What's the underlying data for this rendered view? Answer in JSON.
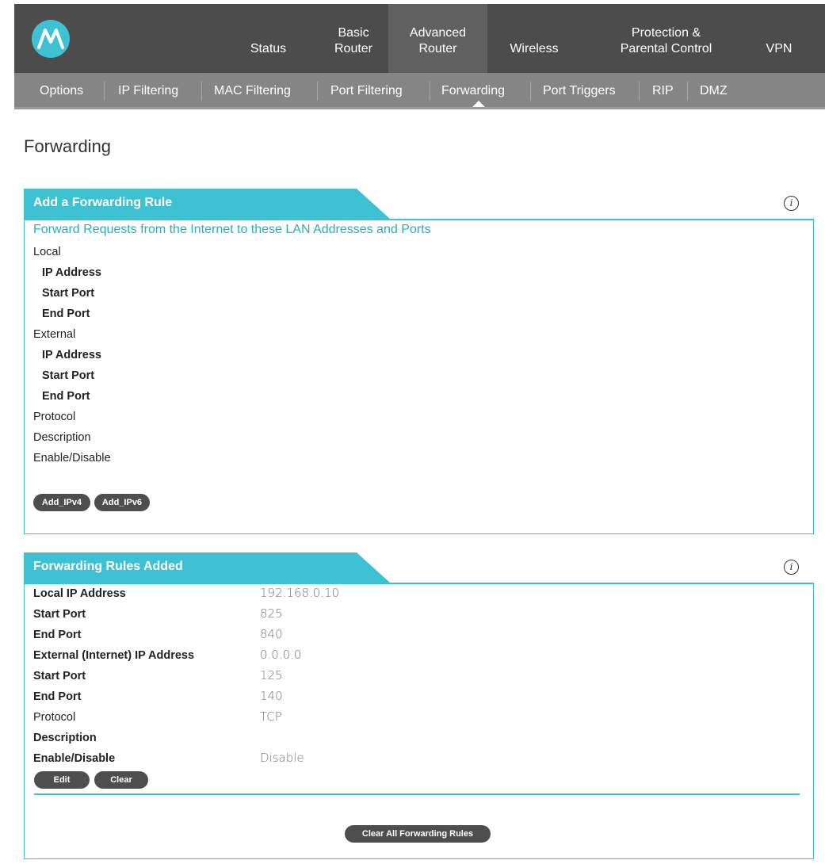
{
  "colors": {
    "accent": "#3fc1d4",
    "nav_bg": "#4c4c4c",
    "nav_active": "#606060",
    "subnav_bg": "#858585",
    "pill": "#4e4e4e"
  },
  "logo": {
    "icon": "motorola-logo-icon"
  },
  "nav": {
    "items": [
      {
        "label": "Status"
      },
      {
        "label": "Basic\nRouter"
      },
      {
        "label": "Advanced\nRouter",
        "active": true
      },
      {
        "label": "Wireless"
      },
      {
        "label": "Protection &\nParental Control"
      },
      {
        "label": "VPN"
      }
    ]
  },
  "subnav": {
    "items": [
      {
        "label": "Options"
      },
      {
        "label": "IP Filtering"
      },
      {
        "label": "MAC Filtering"
      },
      {
        "label": "Port Filtering"
      },
      {
        "label": "Forwarding",
        "active": true
      },
      {
        "label": "Port Triggers"
      },
      {
        "label": "RIP"
      },
      {
        "label": "DMZ"
      }
    ]
  },
  "page_title": "Forwarding",
  "add_panel": {
    "tab_title": "Add a Forwarding Rule",
    "heading": "Forward Requests from the Internet to these LAN Addresses and Ports",
    "labels": {
      "local": "Local",
      "local_ip": "IP Address",
      "local_start": "Start Port",
      "local_end": "End Port",
      "external": "External",
      "ext_ip": "IP Address",
      "ext_start": "Start Port",
      "ext_end": "End Port",
      "protocol": "Protocol",
      "description": "Description",
      "enable": "Enable/Disable"
    },
    "buttons": {
      "add_ipv4": "Add_IPv4",
      "add_ipv6": "Add_IPv6"
    }
  },
  "rules_panel": {
    "tab_title": "Forwarding Rules Added",
    "rows": [
      {
        "label": "Local IP Address",
        "value": "192.168.0.10"
      },
      {
        "label": "Start Port",
        "value": "825"
      },
      {
        "label": "End Port",
        "value": "840"
      },
      {
        "label": "External (Internet) IP Address",
        "value": "0.0.0.0"
      },
      {
        "label": "Start Port",
        "value": "125"
      },
      {
        "label": "End Port",
        "value": "140"
      },
      {
        "label": "Protocol",
        "value": "TCP"
      },
      {
        "label": "Description",
        "value": ""
      },
      {
        "label": "Enable/Disable",
        "value": "Disable"
      }
    ],
    "buttons": {
      "edit": "Edit",
      "clear": "Clear",
      "clear_all": "Clear All Forwarding Rules"
    }
  }
}
